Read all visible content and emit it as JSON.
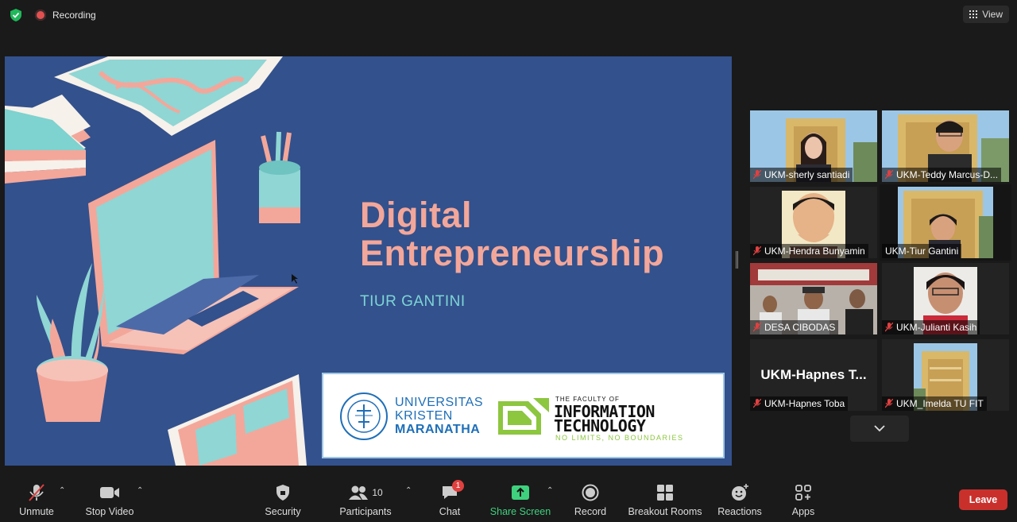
{
  "top_bar": {
    "recording_label": "Recording",
    "view_label": "View",
    "colors": {
      "shield": "#1fb85a",
      "recording_dot": "#e25050"
    }
  },
  "slide": {
    "title_line1": "Digital",
    "title_line2": "Entrepreneurship",
    "presenter": "TIUR GANTINI",
    "university_line1": "UNIVERSITAS",
    "university_line2": "KRISTEN",
    "university_line3": "MARANATHA",
    "faculty_small": "THE FACULTY OF",
    "faculty_line1": "INFORMATION",
    "faculty_line2": "TECHNOLOGY",
    "faculty_tagline": "NO LIMITS, NO BOUNDARIES",
    "colors": {
      "background": "#33518c",
      "title": "#f3a79a",
      "subtitle": "#7dd5d5"
    }
  },
  "participants_gallery": [
    {
      "name": "UKM-sherly santiadi",
      "muted": true,
      "active": false
    },
    {
      "name": "UKM-Teddy Marcus-D...",
      "muted": true,
      "active": false
    },
    {
      "name": "UKM-Hendra Bunyamin",
      "muted": true,
      "active": false
    },
    {
      "name": "UKM-Tiur Gantini",
      "muted": false,
      "active": true
    },
    {
      "name": "DESA CIBODAS",
      "muted": true,
      "active": false
    },
    {
      "name": "UKM-Julianti Kasih",
      "muted": true,
      "active": false
    },
    {
      "name": "UKM-Hapnes Toba",
      "muted": true,
      "active": false,
      "placeholder": "UKM-Hapnes  T..."
    },
    {
      "name": "UKM_Imelda TU FIT",
      "muted": true,
      "active": false
    }
  ],
  "toolbar": {
    "unmute": "Unmute",
    "stop_video": "Stop Video",
    "security": "Security",
    "participants": "Participants",
    "participants_count": "10",
    "chat": "Chat",
    "chat_badge": "1",
    "share_screen": "Share Screen",
    "record": "Record",
    "breakout_rooms": "Breakout Rooms",
    "reactions": "Reactions",
    "apps": "Apps",
    "leave": "Leave",
    "colors": {
      "share": "#3fd07d",
      "leave": "#c9302c",
      "badge": "#e0413f"
    }
  }
}
